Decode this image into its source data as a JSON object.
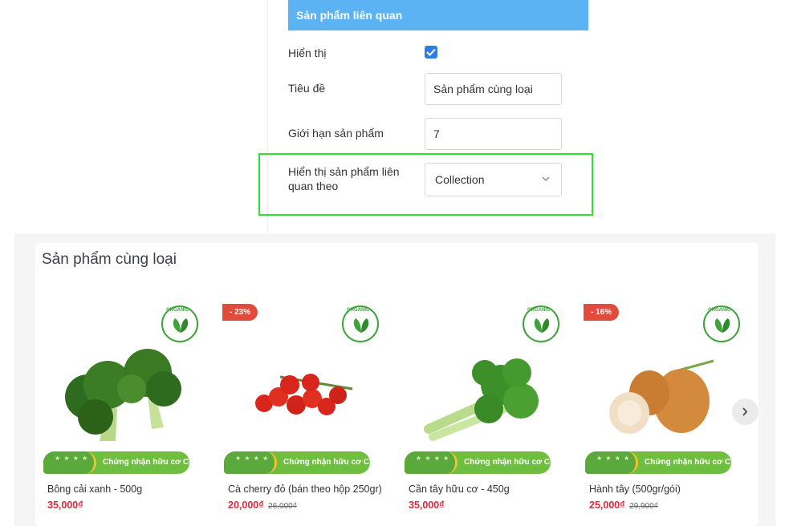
{
  "settings": {
    "header": "Sản phẩm liên quan",
    "show_label": "Hiển thị",
    "show_checked": true,
    "title_label": "Tiêu đề",
    "title_value": "Sản phẩm cùng loại",
    "limit_label": "Giới hạn sản phẩm",
    "limit_value": "7",
    "related_by_label_line1": "Hiển thị sản phẩm liên",
    "related_by_label_line2": "quan theo",
    "related_by_value": "Collection"
  },
  "products_section": {
    "title": "Sản phẩm cùng loại",
    "badge_text": "ORGANIC",
    "cert_text": "Chứng nhận hữu cơ Châu Âu",
    "items": [
      {
        "name": "Bông cải xanh - 500g",
        "price": "35,000₫",
        "old_price": "",
        "discount": "",
        "image": "broccoli-image"
      },
      {
        "name": "Cà cherry đỏ (bán theo hộp 250gr)",
        "price": "20,000₫",
        "old_price": "26,000₫",
        "discount": "- 23%",
        "image": "cherry-tomato-image"
      },
      {
        "name": "Cần tây hữu cơ - 450g",
        "price": "35,000₫",
        "old_price": "",
        "discount": "",
        "image": "celery-image"
      },
      {
        "name": "Hành tây (500gr/gói)",
        "price": "25,000₫",
        "old_price": "29,900₫",
        "discount": "- 16%",
        "image": "onion-image"
      }
    ]
  },
  "colors": {
    "header_blue": "#5bb3f3",
    "checkbox_blue": "#2f7de1",
    "highlight_green": "#2ee22b",
    "price_red": "#e0283e",
    "discount_red": "#e14b3b",
    "organic_green": "#6ebf3d"
  }
}
